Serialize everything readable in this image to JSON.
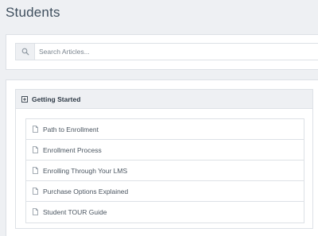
{
  "page": {
    "title": "Students"
  },
  "search": {
    "placeholder": "Search Articles..."
  },
  "category": {
    "title": "Getting Started",
    "articles": [
      {
        "label": "Path to Enrollment"
      },
      {
        "label": "Enrollment Process"
      },
      {
        "label": "Enrolling Through Your LMS"
      },
      {
        "label": "Purchase Options Explained"
      },
      {
        "label": "Student TOUR Guide"
      }
    ]
  },
  "icons": {
    "search": "search-icon",
    "category": "plus-square-icon",
    "article": "document-icon"
  },
  "colors": {
    "background": "#eef0f3",
    "title": "#3f4f5e",
    "border": "#dde1e6"
  }
}
